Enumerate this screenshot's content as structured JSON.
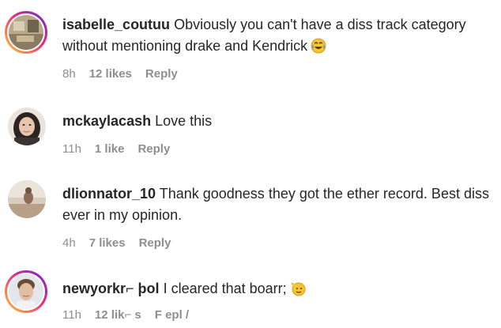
{
  "comments": [
    {
      "username": "isabelle_coutuu",
      "text": "Obviously you can't have a diss track category without mentioning drake and Kendrick",
      "emoji": "tears-of-joy-emoji",
      "time": "8h",
      "likes": "12 likes",
      "reply": "Reply",
      "story_ring": true
    },
    {
      "username": "mckaylacash",
      "text": "Love this",
      "time": "11h",
      "likes": "1 like",
      "reply": "Reply",
      "story_ring": false
    },
    {
      "username": "dlionnator_10",
      "text": "Thank goodness they got the ether record. Best diss ever in my opinion.",
      "time": "4h",
      "likes": "7 likes",
      "reply": "Reply",
      "story_ring": false
    },
    {
      "username": "newyorkr⌐ þol",
      "text": "I cleared that boarr;",
      "emoji": "saluting-face-emoji",
      "time": "11h",
      "likes": "12 lik⌐ s",
      "reply": "F epl /",
      "story_ring": true
    }
  ],
  "colors": {
    "text": "#262626",
    "meta": "#8e8e8e",
    "ring_start": "#f9ce34",
    "ring_mid": "#ee2a7b",
    "ring_end": "#6228d7"
  }
}
